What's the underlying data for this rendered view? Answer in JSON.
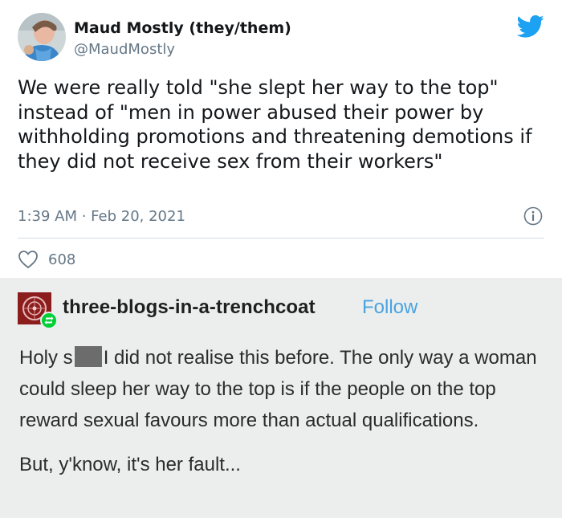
{
  "tweet": {
    "display_name": "Maud Mostly (they/them)",
    "handle": "@MaudMostly",
    "text": "We were really told \"she slept her way to the top\" instead of \"men in power abused their power by withholding promotions and threatening demotions if they did not receive sex from their workers\"",
    "timestamp": "1:39 AM · Feb 20, 2021",
    "like_count": "608",
    "colors": {
      "brand": "#1DA1F2",
      "muted": "#657786",
      "text": "#14171A"
    }
  },
  "post": {
    "username": "three-blogs-in-a-trenchcoat",
    "follow_label": "Follow",
    "body_prefix": "Holy s",
    "body_after_censor": "I did not realise this before. The only way a woman could sleep her way to the top is if the people on the top reward sexual favours more than actual qualifications.",
    "body_second": "But, y'know, it's her fault...",
    "colors": {
      "follow": "#4AA3DF",
      "reblog": "#00CF35",
      "background": "#ECEEEE"
    }
  }
}
